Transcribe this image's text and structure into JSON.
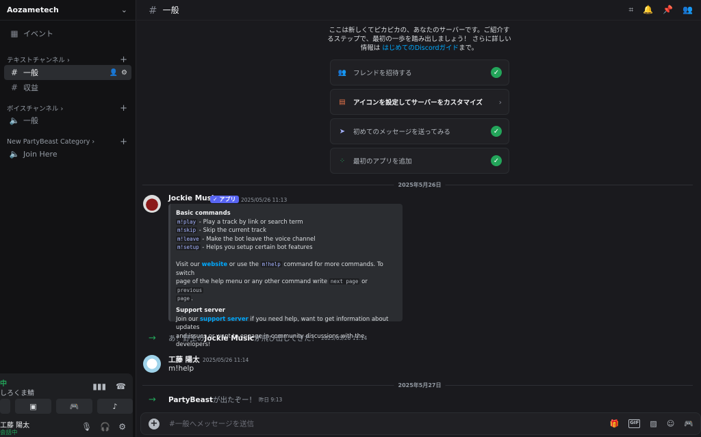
{
  "sidebar": {
    "server_name": "Aozametech",
    "events_label": "イベント",
    "text_category": "テキストチャンネル",
    "text_channels": [
      "一般",
      "収益"
    ],
    "voice_category": "ボイスチャンネル",
    "voice_channels": [
      "一般"
    ],
    "partybeast_category": "New PartyBeast Category",
    "partybeast_channels": [
      "Join Here"
    ]
  },
  "voice_panel": {
    "status": "中",
    "channel": "しろくま鯖"
  },
  "user": {
    "name": "工藤 陽太",
    "status": "会話中"
  },
  "header": {
    "channel_name": "一般"
  },
  "intro": {
    "line1": "ここは新しくてピカピカの、あなたのサーバーです。ご紹介す",
    "line2": "るステップで、最初の一歩を踏み出しましょう！ さらに詳しい",
    "line3_prefix": "情報は",
    "line3_link": "はじめてのDiscordガイド",
    "line3_suffix": "まで。"
  },
  "tasks": [
    {
      "label": "フレンドを招待する",
      "done": true
    },
    {
      "label": "アイコンを設定してサーバーをカスタマイズ",
      "done": false
    },
    {
      "label": "初めてのメッセージを送ってみる",
      "done": true
    },
    {
      "label": "最初のアプリを追加",
      "done": true
    }
  ],
  "dividers": [
    "2025年5月26日",
    "2025年5月27日"
  ],
  "messages": {
    "jockie": {
      "author": "Jockie Music",
      "badge": "✓ アプリ",
      "time": "2025/05/26 11:13",
      "embed": {
        "heading": "Basic commands",
        "commands": [
          {
            "cmd": "m!play",
            "desc": " - Play a track by link or search term"
          },
          {
            "cmd": "m!skip",
            "desc": " - Skip the current track"
          },
          {
            "cmd": "m!leave",
            "desc": " - Make the bot leave the voice channel"
          },
          {
            "cmd": "m!setup",
            "desc": " - Helps you setup certain bot features"
          }
        ],
        "visit_1": "Visit our ",
        "visit_link": "website",
        "visit_2": " or use the ",
        "visit_cmd": "m!help",
        "visit_3": " command for more commands. To switch",
        "visit_4": "page of the help menu or any other command write ",
        "next_code": "next page",
        "visit_or": " or ",
        "prev_code": "previous",
        "page_code": "page",
        "visit_end": ".",
        "support_heading": "Support server",
        "join_1": "Join our ",
        "join_link": "support server",
        "join_2": " if you need help, want to get information about updates",
        "join_3": "and issues or want to engage in community discussions with the developers!"
      }
    },
    "join_jockie": {
      "prefix": "あ！野生の",
      "name": "Jockie Music",
      "suffix": "が飛び出してきた！",
      "time": "2025/05/26 11:14"
    },
    "kudo": {
      "author": "工藤 陽太",
      "time": "2025/05/26 11:14",
      "text": "m!help"
    },
    "join_partybeast": {
      "name": "PartyBeast",
      "suffix": "が出たぞー！",
      "time": "昨日 9:13"
    }
  },
  "composer": {
    "placeholder": "#一般へメッセージを送信",
    "gif_label": "GIF"
  }
}
